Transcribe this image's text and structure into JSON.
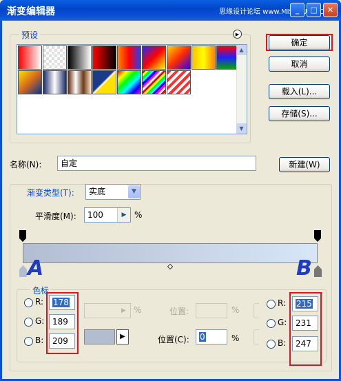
{
  "window": {
    "title": "渐变编辑器",
    "watermark": "思缘设计论坛 www.MISSYUAN.COM",
    "min_glyph": "_",
    "max_glyph": "□",
    "close_glyph": "✕"
  },
  "presets": {
    "legend": "预设",
    "menu_glyph": "▶",
    "scroll_up_glyph": "▲",
    "scroll_down_glyph": "▼",
    "swatches": [
      "linear-gradient(90deg,#ff0000,#ffffff)",
      "repeating-conic-gradient(#e0e0e0 0% 25%,#ffffff 0% 50%) 0 0/8px 8px, linear-gradient(135deg,#ff0000,transparent)",
      "linear-gradient(90deg,#000000,#ffffff)",
      "linear-gradient(90deg,#ff0000,#000000)",
      "linear-gradient(90deg,#ff8800,#ff0000,#2040ff)",
      "linear-gradient(135deg,#1a2bff,#ff0000,#ffff00)",
      "linear-gradient(135deg,#ffd400,#ff2d00 50%,#2a00ff)",
      "linear-gradient(90deg,#ffc000,#ffff00,#ff8000)",
      "linear-gradient(180deg,#ff0000,#2020ff,#00aa00)",
      "linear-gradient(135deg,#ffe000,#d2691e,#003399)",
      "linear-gradient(90deg,#1a2b6b,#ffffff,#1a2b6b)",
      "linear-gradient(90deg,#6b2a10,#ffffff,#6b3a1a,#ffe0c0)",
      "linear-gradient(135deg,#1a3a8a 45%,#ffffff 50%,#ffe000 55%)",
      "linear-gradient(135deg,#ff0000,#ffff00,#00ff00,#00ffff,#0000ff,#ff00ff)",
      "repeating-linear-gradient(135deg,#ff0000 0 3px,#ffff00 3px 6px,#00ff00 6px 9px,#00ffff 9px 12px,#0000ff 12px 15px,#ff00ff 15px 18px,#ffffff 18px 21px)",
      "repeating-linear-gradient(135deg,#ff3030 0 4px,#ffffff 4px 8px)"
    ]
  },
  "buttons": {
    "ok": "确定",
    "cancel": "取消",
    "load": "载入(L)...",
    "save": "存储(S)...",
    "new": "新建(W)"
  },
  "name": {
    "label": "名称(N):",
    "value": "自定"
  },
  "gradient_type": {
    "label": "渐变类型(T):",
    "value": "实底",
    "smoothness_label": "平滑度(M):",
    "smoothness_value": "100",
    "percent": "%"
  },
  "gradient_bar": {
    "color_start": "#b2bdd1",
    "color_end": "#d7e7f7",
    "label_a": "A",
    "label_b": "B",
    "accent": "#e0141e",
    "annotation_color": "#1e3cc8"
  },
  "color_stops": {
    "legend": "色标",
    "opacity_percent": "%",
    "location_label_top": "位置:",
    "location_top_percent": "%",
    "color_label": "",
    "arrow_glyph": "▶",
    "location_label": "位置(C):",
    "location_value": "0",
    "location_percent": "%",
    "left": {
      "r_label": "R:",
      "g_label": "G:",
      "b_label": "B:",
      "r": "178",
      "g": "189",
      "b": "209"
    },
    "right": {
      "r_label": "R:",
      "g_label": "G:",
      "b_label": "B:",
      "r": "215",
      "g": "231",
      "b": "247"
    },
    "swatch_color": "#b2bdd1"
  }
}
